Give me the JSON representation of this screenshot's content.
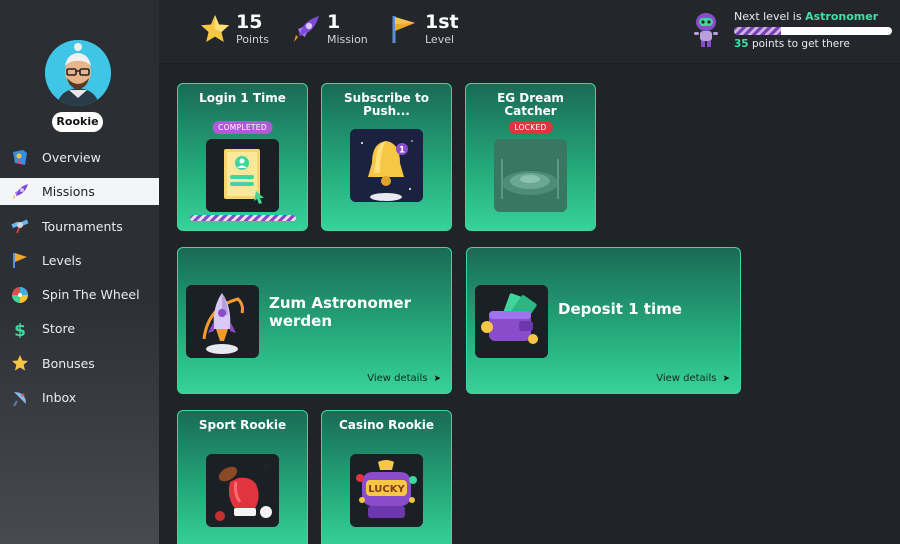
{
  "profile": {
    "rank": "Rookie"
  },
  "nav": [
    {
      "label": "Overview",
      "icon": "map-pin-icon"
    },
    {
      "label": "Missions",
      "icon": "rocket-icon",
      "active": true
    },
    {
      "label": "Tournaments",
      "icon": "satellite-icon"
    },
    {
      "label": "Levels",
      "icon": "flag-icon"
    },
    {
      "label": "Spin The Wheel",
      "icon": "wheel-icon"
    },
    {
      "label": "Store",
      "icon": "dollar-icon"
    },
    {
      "label": "Bonuses",
      "icon": "star-icon"
    },
    {
      "label": "Inbox",
      "icon": "satellite-dish-icon"
    }
  ],
  "stats": {
    "points": {
      "value": "15",
      "caption": "Points"
    },
    "mission": {
      "value": "1",
      "caption": "Mission"
    },
    "level": {
      "value": "1st",
      "caption": "Level"
    }
  },
  "next_level": {
    "prefix": "Next level is",
    "name": "Astronomer",
    "points": "35",
    "suffix": "points to get there",
    "progress": 0.3
  },
  "missions": [
    {
      "title": "Login 1 Time",
      "tag": "COMPLETED",
      "tag_color": "#b05bd6",
      "progress": 1.0
    },
    {
      "title": "Subscribe to Push...",
      "tag": ""
    },
    {
      "title": "EG Dream Catcher",
      "tag": "LOCKED",
      "tag_color": "#e0343f"
    },
    {
      "title": "Zum Astronomer werden",
      "link": "View details"
    },
    {
      "title": "Deposit 1 time",
      "link": "View details"
    },
    {
      "title": "Sport Rookie"
    },
    {
      "title": "Casino Rookie"
    }
  ],
  "colors": {
    "accent": "#3fe0a8",
    "card_border": "#3fd69c",
    "active_nav_bg": "#f4f5f6"
  }
}
